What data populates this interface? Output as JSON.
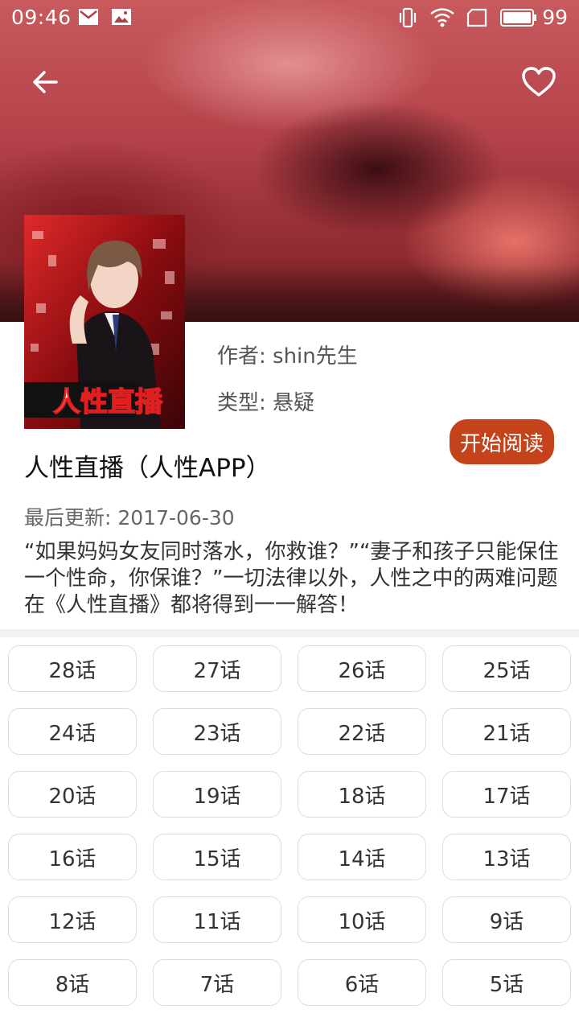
{
  "status_bar": {
    "time": "09:46",
    "battery": "99",
    "icons": [
      "mail-icon",
      "image-icon",
      "vibrate-icon",
      "wifi-icon",
      "sim-icon",
      "battery-icon"
    ]
  },
  "top_bar": {
    "back_icon": "arrow-left-icon",
    "favorite_icon": "heart-outline-icon"
  },
  "comic": {
    "author": "作者: shin先生",
    "type": "类型: 悬疑",
    "title": "人性直播（人性APP）",
    "updated": "最后更新: 2017-06-30",
    "description": "“如果妈妈女友同时落水，你救谁？”“妻子和孩子只能保住一个性命，你保谁？”一切法律以外，人性之中的两难问题在《人性直播》都将得到一一解答！",
    "read_button": "开始阅读",
    "cover_title": "人性直播"
  },
  "chapters": [
    "28话",
    "27话",
    "26话",
    "25话",
    "24话",
    "23话",
    "22话",
    "21话",
    "20话",
    "19话",
    "18话",
    "17话",
    "16话",
    "15话",
    "14话",
    "13话",
    "12话",
    "11话",
    "10话",
    "9话",
    "8话",
    "7话",
    "6话",
    "5话"
  ],
  "colors": {
    "accent": "#c4431a",
    "banner": "#b24048"
  }
}
